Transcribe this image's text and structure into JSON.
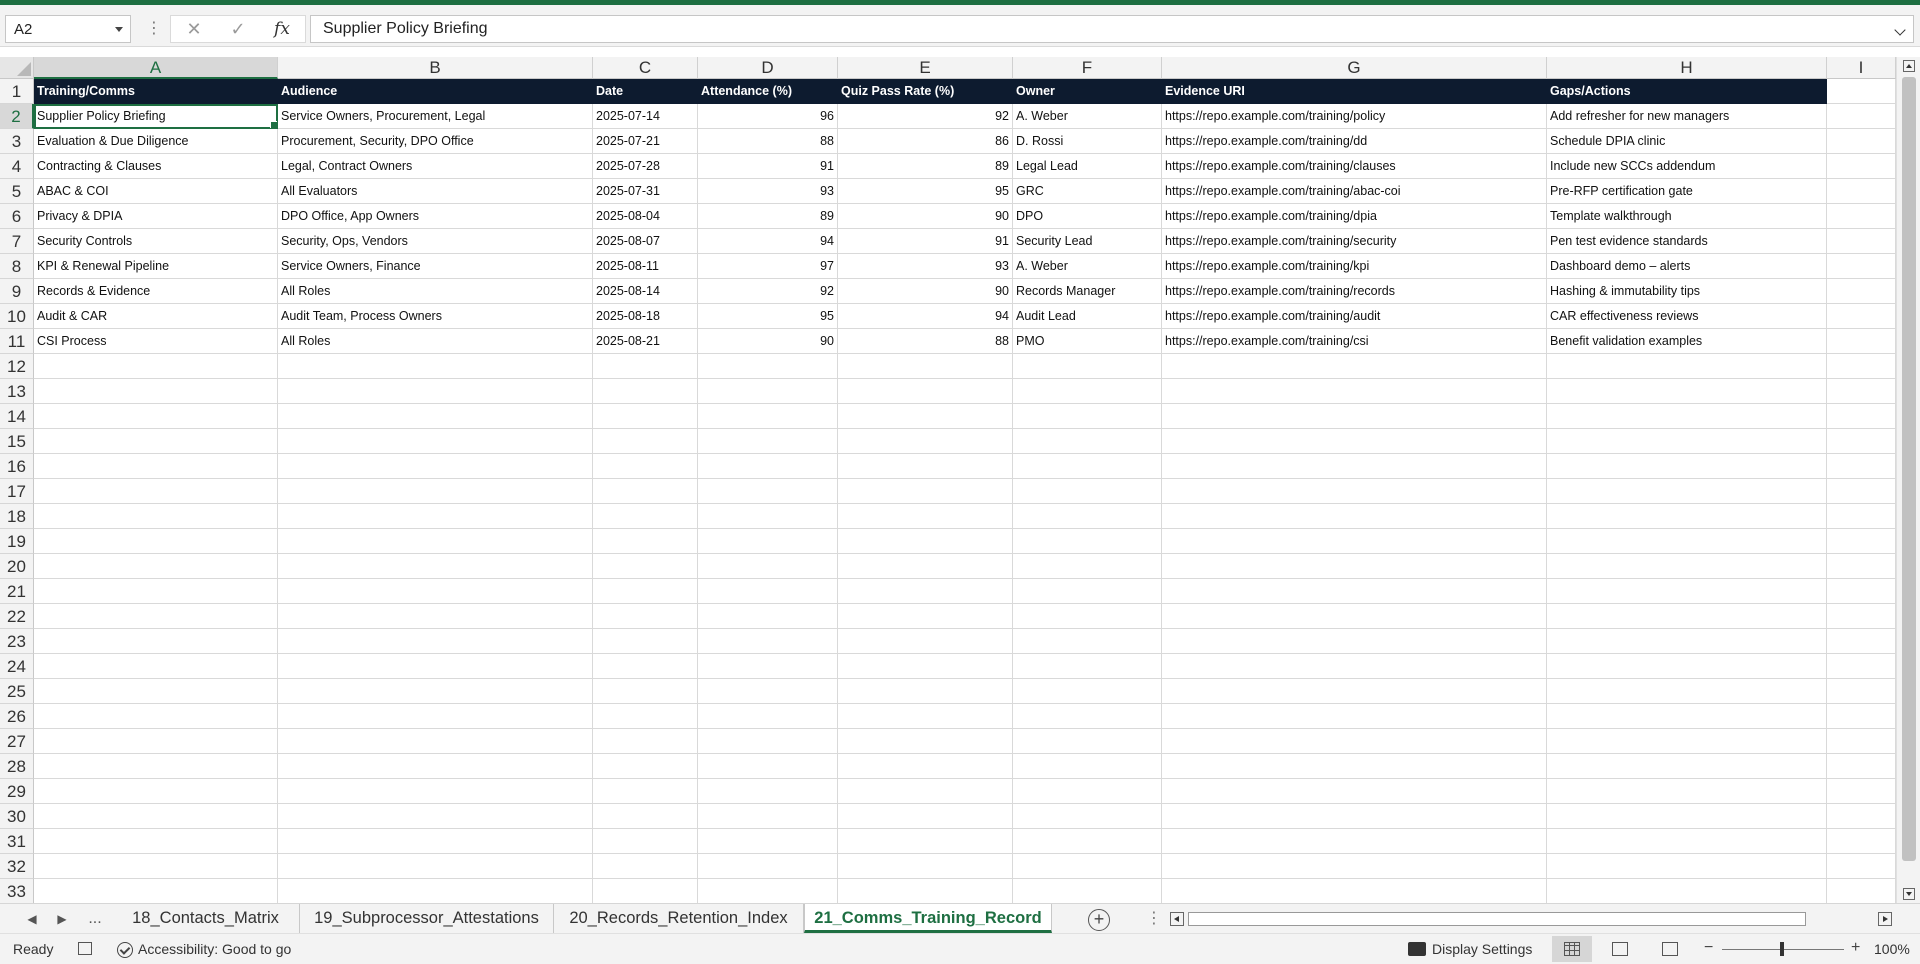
{
  "formula_bar": {
    "name_box": "A2",
    "cancel_icon": "✕",
    "enter_icon": "✓",
    "fx_label": "fx",
    "formula": "Supplier Policy Briefing"
  },
  "columns": [
    "A",
    "B",
    "C",
    "D",
    "E",
    "F",
    "G",
    "H",
    "I"
  ],
  "rows": [
    "1",
    "2",
    "3",
    "4",
    "5",
    "6",
    "7",
    "8",
    "9",
    "10",
    "11",
    "12",
    "13",
    "14",
    "15",
    "16",
    "17",
    "18",
    "19",
    "20",
    "21",
    "22",
    "23",
    "24",
    "25",
    "26",
    "27",
    "28",
    "29",
    "30",
    "31",
    "32",
    "33"
  ],
  "table": {
    "headers": [
      "Training/Comms",
      "Audience",
      "Date",
      "Attendance (%)",
      "Quiz Pass Rate (%)",
      "Owner",
      "Evidence URI",
      "Gaps/Actions"
    ],
    "rows": [
      [
        "Supplier Policy Briefing",
        "Service Owners, Procurement, Legal",
        "2025-07-14",
        "96",
        "92",
        "A. Weber",
        "https://repo.example.com/training/policy",
        "Add refresher for new managers"
      ],
      [
        "Evaluation & Due Diligence",
        "Procurement, Security, DPO Office",
        "2025-07-21",
        "88",
        "86",
        "D. Rossi",
        "https://repo.example.com/training/dd",
        "Schedule DPIA clinic"
      ],
      [
        "Contracting & Clauses",
        "Legal, Contract Owners",
        "2025-07-28",
        "91",
        "89",
        "Legal Lead",
        "https://repo.example.com/training/clauses",
        "Include new SCCs addendum"
      ],
      [
        "ABAC & COI",
        "All Evaluators",
        "2025-07-31",
        "93",
        "95",
        "GRC",
        "https://repo.example.com/training/abac-coi",
        "Pre-RFP certification gate"
      ],
      [
        "Privacy & DPIA",
        "DPO Office, App Owners",
        "2025-08-04",
        "89",
        "90",
        "DPO",
        "https://repo.example.com/training/dpia",
        "Template walkthrough"
      ],
      [
        "Security Controls",
        "Security, Ops, Vendors",
        "2025-08-07",
        "94",
        "91",
        "Security Lead",
        "https://repo.example.com/training/security",
        "Pen test evidence standards"
      ],
      [
        "KPI & Renewal Pipeline",
        "Service Owners, Finance",
        "2025-08-11",
        "97",
        "93",
        "A. Weber",
        "https://repo.example.com/training/kpi",
        "Dashboard demo – alerts"
      ],
      [
        "Records & Evidence",
        "All Roles",
        "2025-08-14",
        "92",
        "90",
        "Records Manager",
        "https://repo.example.com/training/records",
        "Hashing & immutability tips"
      ],
      [
        "Audit & CAR",
        "Audit Team, Process Owners",
        "2025-08-18",
        "95",
        "94",
        "Audit Lead",
        "https://repo.example.com/training/audit",
        "CAR effectiveness reviews"
      ],
      [
        "CSI Process",
        "All Roles",
        "2025-08-21",
        "90",
        "88",
        "PMO",
        "https://repo.example.com/training/csi",
        "Benefit validation examples"
      ]
    ]
  },
  "sheet_tabs": {
    "more": "...",
    "tabs": [
      "18_Contacts_Matrix",
      "19_Subprocessor_Attestations",
      "20_Records_Retention_Index",
      "21_Comms_Training_Record"
    ],
    "active": "21_Comms_Training_Record",
    "add_icon": "+"
  },
  "status_bar": {
    "ready": "Ready",
    "accessibility": "Accessibility: Good to go",
    "display_settings": "Display Settings",
    "zoom_minus": "−",
    "zoom_plus": "+",
    "zoom_level": "100%"
  },
  "colors": {
    "accent": "#1e6f42",
    "header_fill": "#0d1b2f"
  }
}
